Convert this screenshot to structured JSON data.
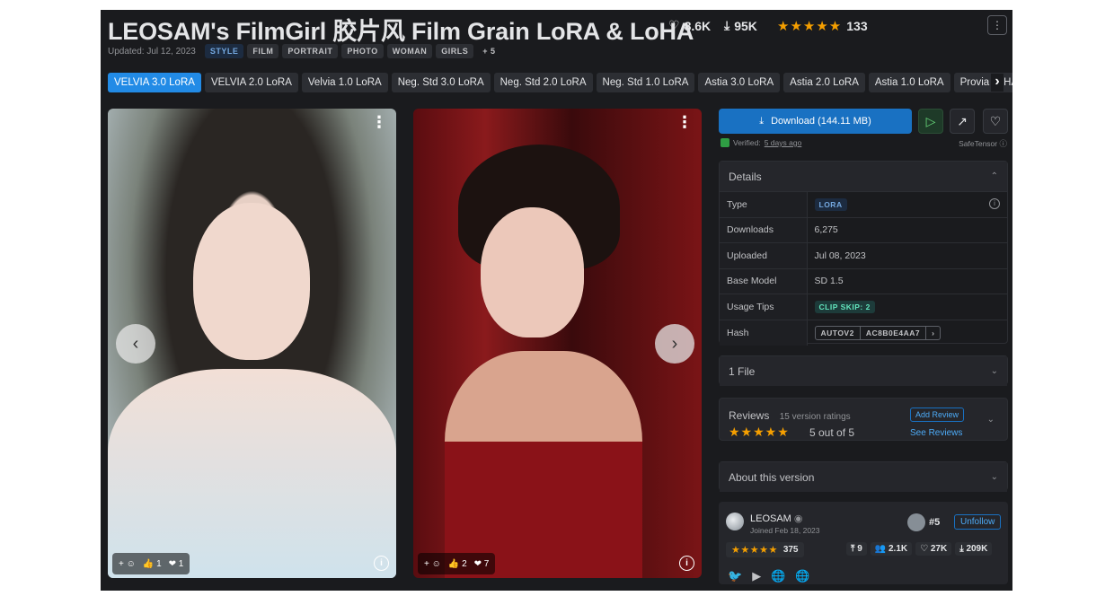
{
  "header": {
    "title": "LEOSAM's FilmGirl 胶片风 Film Grain LoRA & LoHA",
    "likes": "8.6K",
    "downloads": "95K",
    "rating_count": "133",
    "updated": "Updated: Jul 12, 2023",
    "tags": [
      "STYLE",
      "FILM",
      "PORTRAIT",
      "PHOTO",
      "WOMAN",
      "GIRLS",
      "+ 5"
    ]
  },
  "versions": [
    "VELVIA 3.0 LoRA",
    "VELVIA 2.0 LoRA",
    "Velvia 1.0 LoRA",
    "Neg. Std 3.0 LoRA",
    "Neg. Std 2.0 LoRA",
    "Neg. Std 1.0 LoRA",
    "Astia 3.0 LoRA",
    "Astia 2.0 LoRA",
    "Astia 1.0 LoRA",
    "Provia LoHA"
  ],
  "gallery": {
    "card1": {
      "thumbs": "1",
      "hearts": "1"
    },
    "card2": {
      "thumbs": "2",
      "hearts": "7"
    }
  },
  "download": {
    "label": "Download (144.11 MB)",
    "verified": "Verified:",
    "verified_when": "5 days ago",
    "format": "SafeTensor"
  },
  "details": {
    "heading": "Details",
    "rows": [
      {
        "k": "Type",
        "v": "LORA"
      },
      {
        "k": "Downloads",
        "v": "6,275"
      },
      {
        "k": "Uploaded",
        "v": "Jul 08, 2023"
      },
      {
        "k": "Base Model",
        "v": "SD 1.5"
      },
      {
        "k": "Usage Tips",
        "v": "CLIP SKIP: 2"
      },
      {
        "k": "Hash",
        "v1": "AUTOV2",
        "v2": "AC8B0E4AA7"
      }
    ]
  },
  "files": {
    "label": "1 File"
  },
  "reviews": {
    "title": "Reviews",
    "count": "15 version ratings",
    "score": "5 out of 5",
    "add": "Add Review",
    "see": "See Reviews"
  },
  "about": {
    "label": "About this version"
  },
  "creator": {
    "name": "LEOSAM",
    "joined": "Joined Feb 18, 2023",
    "rank": "#5",
    "unfollow": "Unfollow",
    "rating": "375",
    "uploads": "9",
    "followers": "2.1K",
    "likes": "27K",
    "downloads": "209K"
  }
}
